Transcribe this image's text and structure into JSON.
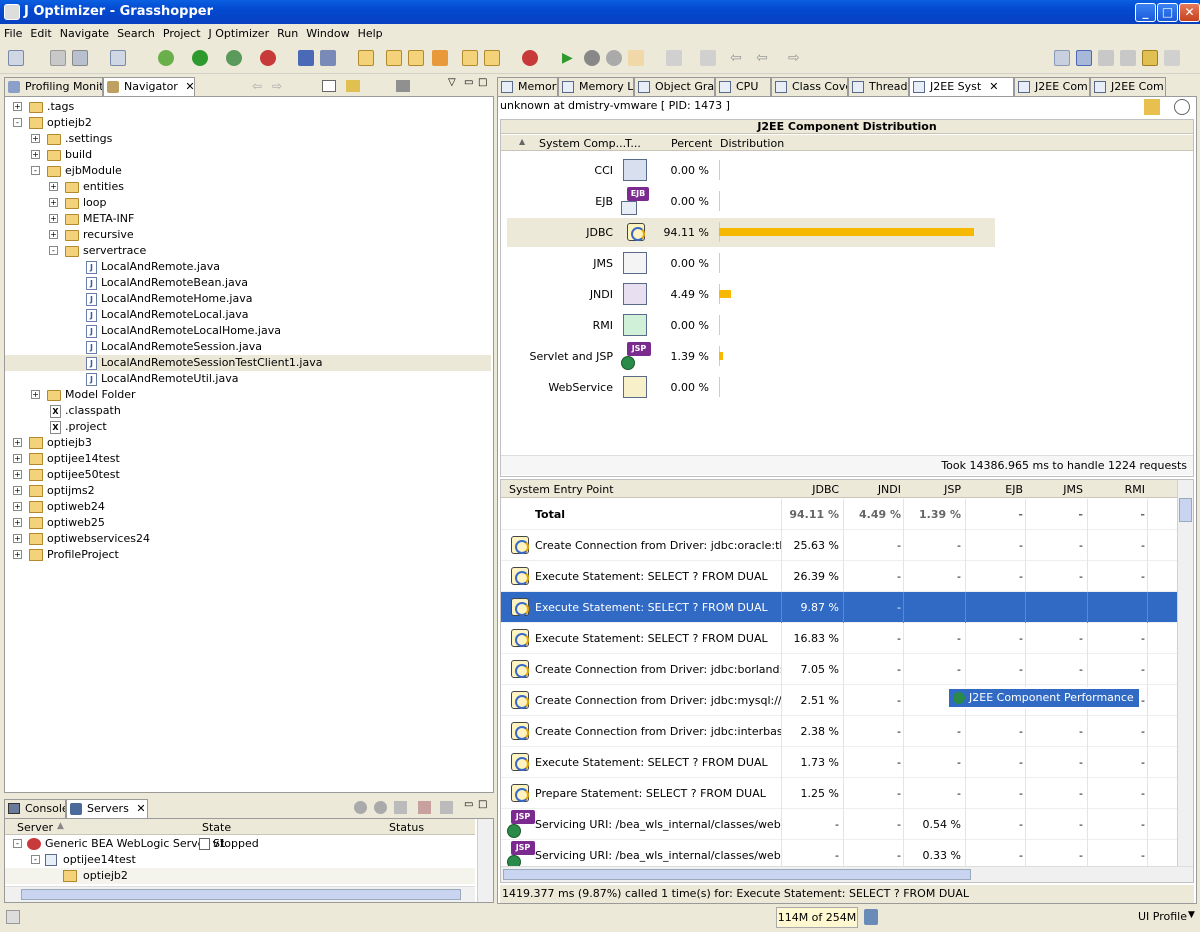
{
  "window": {
    "title": "J Optimizer - Grasshopper"
  },
  "menu": [
    "File",
    "Edit",
    "Navigate",
    "Search",
    "Project",
    "J Optimizer",
    "Run",
    "Window",
    "Help"
  ],
  "left_tabs": {
    "profiling": "Profiling Monitor",
    "navigator": "Navigator"
  },
  "tree": [
    {
      "label": ".tags",
      "level": 0,
      "kind": "folder",
      "exp": "+"
    },
    {
      "label": "optiejb2",
      "level": 0,
      "kind": "project",
      "exp": "-"
    },
    {
      "label": ".settings",
      "level": 1,
      "kind": "folder",
      "exp": "+"
    },
    {
      "label": "build",
      "level": 1,
      "kind": "folder",
      "exp": "+"
    },
    {
      "label": "ejbModule",
      "level": 1,
      "kind": "folder",
      "exp": "-"
    },
    {
      "label": "entities",
      "level": 2,
      "kind": "folder",
      "exp": "+"
    },
    {
      "label": "loop",
      "level": 2,
      "kind": "folder",
      "exp": "+"
    },
    {
      "label": "META-INF",
      "level": 2,
      "kind": "folder",
      "exp": "+"
    },
    {
      "label": "recursive",
      "level": 2,
      "kind": "folder",
      "exp": "+"
    },
    {
      "label": "servertrace",
      "level": 2,
      "kind": "folder",
      "exp": "-"
    },
    {
      "label": "LocalAndRemote.java",
      "level": 3,
      "kind": "java"
    },
    {
      "label": "LocalAndRemoteBean.java",
      "level": 3,
      "kind": "java"
    },
    {
      "label": "LocalAndRemoteHome.java",
      "level": 3,
      "kind": "java"
    },
    {
      "label": "LocalAndRemoteLocal.java",
      "level": 3,
      "kind": "java"
    },
    {
      "label": "LocalAndRemoteLocalHome.java",
      "level": 3,
      "kind": "java"
    },
    {
      "label": "LocalAndRemoteSession.java",
      "level": 3,
      "kind": "java"
    },
    {
      "label": "LocalAndRemoteSessionTestClient1.java",
      "level": 3,
      "kind": "java",
      "selected": true
    },
    {
      "label": "LocalAndRemoteUtil.java",
      "level": 3,
      "kind": "java"
    },
    {
      "label": "Model Folder",
      "level": 1,
      "kind": "folder",
      "exp": "+"
    },
    {
      "label": ".classpath",
      "level": 1,
      "kind": "x"
    },
    {
      "label": ".project",
      "level": 1,
      "kind": "x"
    },
    {
      "label": "optiejb3",
      "level": 0,
      "kind": "project",
      "exp": "+"
    },
    {
      "label": "optijee14test",
      "level": 0,
      "kind": "project",
      "exp": "+"
    },
    {
      "label": "optijee50test",
      "level": 0,
      "kind": "project",
      "exp": "+"
    },
    {
      "label": "optijms2",
      "level": 0,
      "kind": "project",
      "exp": "+"
    },
    {
      "label": "optiweb24",
      "level": 0,
      "kind": "project",
      "exp": "+"
    },
    {
      "label": "optiweb25",
      "level": 0,
      "kind": "project",
      "exp": "+"
    },
    {
      "label": "optiwebservices24",
      "level": 0,
      "kind": "project",
      "exp": "+"
    },
    {
      "label": "ProfileProject",
      "level": 0,
      "kind": "project",
      "exp": "+"
    }
  ],
  "bottom_tabs": {
    "console": "Console",
    "servers": "Servers"
  },
  "servers": {
    "headers": [
      "Server",
      "State",
      "Status"
    ],
    "rows": [
      {
        "label": "Generic BEA WebLogic Server v1",
        "state": "Stopped",
        "level": 0
      },
      {
        "label": "optijee14test",
        "level": 1
      },
      {
        "label": "optiejb2",
        "level": 2
      }
    ]
  },
  "right_tabs": [
    "Memory",
    "Memory Le",
    "Object Gra",
    "CPU",
    "Class Cove",
    "Threads",
    "J2EE Syst",
    "J2EE Com",
    "J2EE Com"
  ],
  "session": "unknown at dmistry-vmware [ PID: 1473 ]",
  "dist": {
    "title": "J2EE Component Distribution",
    "headers": [
      "System Comp...",
      "T...",
      "Percent",
      "Distribution"
    ],
    "rows": [
      {
        "name": "CCI",
        "percent": "0.00 %",
        "value": 0.0
      },
      {
        "name": "EJB",
        "percent": "0.00 %",
        "value": 0.0
      },
      {
        "name": "JDBC",
        "percent": "94.11 %",
        "value": 94.11
      },
      {
        "name": "JMS",
        "percent": "0.00 %",
        "value": 0.0
      },
      {
        "name": "JNDI",
        "percent": "4.49 %",
        "value": 4.49
      },
      {
        "name": "RMI",
        "percent": "0.00 %",
        "value": 0.0
      },
      {
        "name": "Servlet and JSP",
        "percent": "1.39 %",
        "value": 1.39
      },
      {
        "name": "WebService",
        "percent": "0.00 %",
        "value": 0.0
      }
    ],
    "footer": "Took 14386.965 ms to handle 1224 requests"
  },
  "entry": {
    "headers": [
      "System Entry Point",
      "JDBC",
      "JNDI",
      "JSP",
      "EJB",
      "JMS",
      "RMI"
    ],
    "rows": [
      {
        "label": "Total",
        "icon": "none",
        "jdbc": "94.11 %",
        "jndi": "4.49 %",
        "jsp": "1.39 %",
        "ejb": "-",
        "jms": "-",
        "rmi": "-"
      },
      {
        "label": "Create Connection from Driver: jdbc:oracle:thin:@s...",
        "icon": "jdbc",
        "jdbc": "25.63 %",
        "jndi": "-",
        "jsp": "-",
        "ejb": "-",
        "jms": "-",
        "rmi": "-"
      },
      {
        "label": "Execute Statement: SELECT ? FROM DUAL",
        "icon": "jdbc",
        "jdbc": "26.39 %",
        "jndi": "-",
        "jsp": "-",
        "ejb": "-",
        "jms": "-",
        "rmi": "-"
      },
      {
        "label": "Execute Statement: SELECT ? FROM DUAL",
        "icon": "jdbc",
        "jdbc": "9.87 %",
        "jndi": "-",
        "jsp": "",
        "ejb": "",
        "jms": "",
        "rmi": "",
        "selected": true
      },
      {
        "label": "Execute Statement: SELECT ? FROM DUAL",
        "icon": "jdbc",
        "jdbc": "16.83 %",
        "jndi": "-",
        "jsp": "-",
        "ejb": "-",
        "jms": "-",
        "rmi": "-"
      },
      {
        "label": "Create Connection from Driver: jdbc:borland:dsrem...",
        "icon": "jdbc",
        "jdbc": "7.05 %",
        "jndi": "-",
        "jsp": "-",
        "ejb": "-",
        "jms": "-",
        "rmi": "-"
      },
      {
        "label": "Create Connection from Driver: jdbc:mysql://localh...",
        "icon": "jdbc",
        "jdbc": "2.51 %",
        "jndi": "-",
        "jsp": "-",
        "ejb": "-",
        "jms": "-",
        "rmi": "-"
      },
      {
        "label": "Create Connection from Driver: jdbc:interbase://loc...",
        "icon": "jdbc",
        "jdbc": "2.38 %",
        "jndi": "-",
        "jsp": "-",
        "ejb": "-",
        "jms": "-",
        "rmi": "-"
      },
      {
        "label": "Execute Statement: SELECT ? FROM DUAL",
        "icon": "jdbc",
        "jdbc": "1.73 %",
        "jndi": "-",
        "jsp": "-",
        "ejb": "-",
        "jms": "-",
        "rmi": "-"
      },
      {
        "label": "Prepare Statement: SELECT ? FROM DUAL",
        "icon": "jdbc",
        "jdbc": "1.25 %",
        "jndi": "-",
        "jsp": "-",
        "ejb": "-",
        "jms": "-",
        "rmi": "-"
      },
      {
        "label": "Servicing URI: /bea_wls_internal/classes/weblogic/...",
        "icon": "jsp",
        "jdbc": "-",
        "jndi": "-",
        "jsp": "0.54 %",
        "ejb": "-",
        "jms": "-",
        "rmi": "-"
      },
      {
        "label": "Servicing URI: /bea_wls_internal/classes/weblogic/j...",
        "icon": "jsp",
        "jdbc": "-",
        "jndi": "-",
        "jsp": "0.33 %",
        "ejb": "-",
        "jms": "-",
        "rmi": "-"
      }
    ],
    "popup": "J2EE Component Performance",
    "status": "1419.377 ms (9.87%) called 1 time(s) for: Execute Statement: SELECT ? FROM DUAL"
  },
  "statusbar": {
    "memory": "114M of 254M",
    "profile": "UI Profile"
  },
  "jsp_badge": "JSP",
  "ejb_badge": "EJB"
}
